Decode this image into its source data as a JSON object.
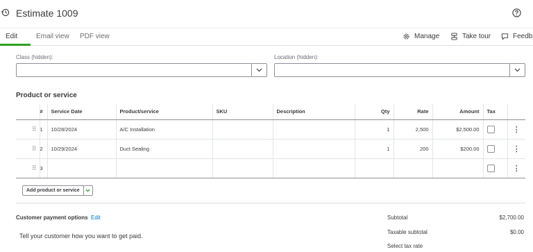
{
  "header": {
    "title": "Estimate 1009"
  },
  "tabs": [
    {
      "label": "Edit"
    },
    {
      "label": "Email view"
    },
    {
      "label": "PDF view"
    }
  ],
  "toolbar": {
    "manage": "Manage",
    "take_tour": "Take tour",
    "feedback": "Feedba"
  },
  "fields": {
    "class_label": "Class (hidden):",
    "location_label": "Location (hidden):"
  },
  "lines": {
    "section_title": "Product or service",
    "columns": [
      "#",
      "Service Date",
      "Product/service",
      "SKU",
      "Description",
      "Qty",
      "Rate",
      "Amount",
      "Tax"
    ],
    "rows": [
      {
        "num": "1",
        "date": "10/28/2024",
        "product": "A/C Installation",
        "sku": "",
        "description": "",
        "qty": "1",
        "rate": "2,500",
        "amount": "$2,500.00"
      },
      {
        "num": "2",
        "date": "10/29/2024",
        "product": "Duct Sealing",
        "sku": "",
        "description": "",
        "qty": "1",
        "rate": "200",
        "amount": "$200.00"
      },
      {
        "num": "3",
        "date": "",
        "product": "",
        "sku": "",
        "description": "",
        "qty": "",
        "rate": "",
        "amount": ""
      }
    ],
    "add_button": "Add product or service"
  },
  "payment": {
    "title": "Customer payment options",
    "edit": "Edit",
    "text": "Tell your customer how you want to get paid."
  },
  "summary": {
    "subtotal_label": "Subtotal",
    "subtotal_value": "$2,700.00",
    "taxable_label": "Taxable subtotal",
    "taxable_value": "$0.00",
    "tax_rate_label": "Select tax rate"
  },
  "colors": {
    "accent_green": "#2ca01c",
    "link_blue": "#0077c5"
  }
}
